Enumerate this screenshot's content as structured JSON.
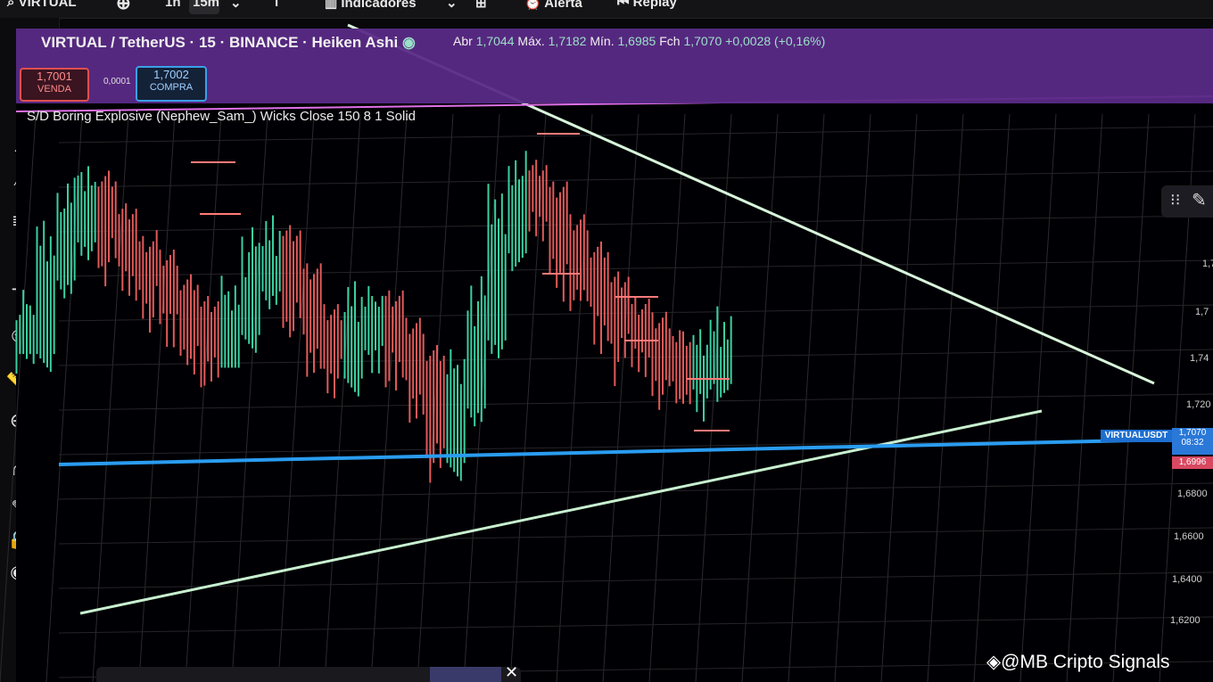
{
  "topbar": {
    "symbol_search": "VIRTUAL",
    "interval_short": "1h",
    "interval_active": "15m",
    "indicators_label": "Indicadores",
    "alert_label": "Alerta",
    "replay_label": "Replay"
  },
  "legend": {
    "title": "VIRTUAL / TetherUS · 15 · BINANCE · Heiken Ashi",
    "open_label": "Abr",
    "open_value": "1,7044",
    "high_label": "Máx.",
    "high_value": "1,7182",
    "low_label": "Mín.",
    "low_value": "1,6985",
    "close_label": "Fch",
    "close_value": "1,7070",
    "change": "+0,0028 (+0,16%)"
  },
  "trade": {
    "sell_price": "1,7001",
    "sell_label": "VENDA",
    "spread": "0,0001",
    "buy_price": "1,7002",
    "buy_label": "COMPRA"
  },
  "indicator": {
    "text": "S/D Boring Explosive (Nephew_Sam_) Wicks Close 150 8 1 Solid"
  },
  "price_axis": {
    "labels": [
      "1,7",
      "1,74",
      "1,720",
      "1,6800",
      "1,6600",
      "1,6400",
      "1,6200"
    ]
  },
  "price_tags": {
    "symbol": "VIRTUALUSDT",
    "last": "1,7070",
    "countdown": "08:32",
    "low": "1,6996"
  },
  "watermark": "@MB Cripto Signals",
  "colors": {
    "purple_band": "#5a2a86",
    "bull": "#3ad0a0",
    "bear": "#e05a5a",
    "trendline": "#c8f0d0",
    "support": "#2a9cf0"
  },
  "chart_data": {
    "type": "candlestick",
    "series": [
      {
        "name": "Heiken Ashi",
        "values": [
          1.715,
          1.742,
          1.756,
          1.764,
          1.752,
          1.74,
          1.735,
          1.726,
          1.718,
          1.71,
          1.722,
          1.738,
          1.744,
          1.73,
          1.715,
          1.706,
          1.718,
          1.72,
          1.71,
          1.7,
          1.675,
          1.695,
          1.72,
          1.752,
          1.768,
          1.76,
          1.748,
          1.738,
          1.727,
          1.717,
          1.712,
          1.705,
          1.702,
          1.704,
          1.707
        ]
      }
    ],
    "ylim": [
      1.61,
      1.79
    ],
    "support_level": 1.699,
    "grid": true
  }
}
